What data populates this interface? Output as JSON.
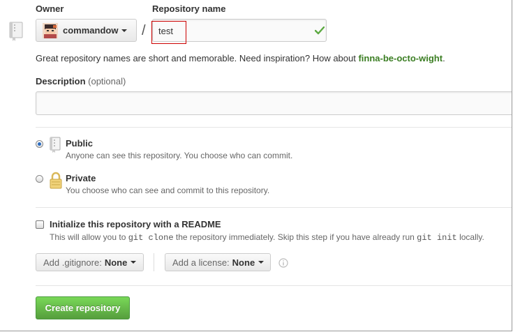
{
  "owner": {
    "label": "Owner",
    "value": "commandow"
  },
  "repo_name": {
    "label": "Repository name",
    "value": "test",
    "valid": true
  },
  "separator": "/",
  "hint": {
    "text": "Great repository names are short and memorable. Need inspiration? How about ",
    "suggestion": "finna-be-octo-wight",
    "suffix": "."
  },
  "description": {
    "label": "Description",
    "optional": "(optional)",
    "value": ""
  },
  "visibility": {
    "public": {
      "label": "Public",
      "desc": "Anyone can see this repository. You choose who can commit.",
      "checked": true
    },
    "private": {
      "label": "Private",
      "desc": "You choose who can see and commit to this repository.",
      "checked": false
    }
  },
  "readme": {
    "label": "Initialize this repository with a README",
    "desc_1": "This will allow you to ",
    "code_1": "git clone",
    "desc_2": " the repository immediately. Skip this step if you have already run ",
    "code_2": "git init",
    "desc_3": " locally.",
    "checked": false
  },
  "gitignore": {
    "label": "Add .gitignore:",
    "value": "None"
  },
  "license": {
    "label": "Add a license:",
    "value": "None"
  },
  "create_button": "Create repository",
  "icons": {
    "repo": "repo-book-icon",
    "valid": "check-icon",
    "public": "public-repo-icon",
    "private": "lock-icon",
    "info": "info-icon"
  },
  "colors": {
    "accent_green": "#5ca941",
    "suggestion_green": "#3a7d22",
    "highlight_red": "#cc0000",
    "radio_blue": "#2a6bbf"
  }
}
